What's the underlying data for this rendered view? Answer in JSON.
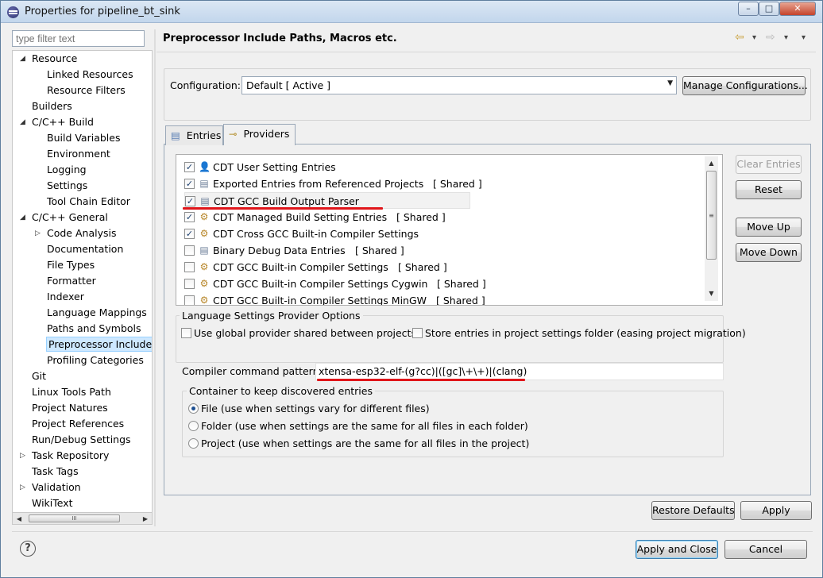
{
  "window": {
    "title": "Properties for pipeline_bt_sink",
    "controls": [
      "–",
      "□",
      "✕"
    ]
  },
  "filter": {
    "placeholder": "type filter text"
  },
  "tree": [
    {
      "label": "Resource",
      "indent": 0,
      "expander": "◢"
    },
    {
      "label": "Linked Resources",
      "indent": 1
    },
    {
      "label": "Resource Filters",
      "indent": 1
    },
    {
      "label": "Builders",
      "indent": 0
    },
    {
      "label": "C/C++ Build",
      "indent": 0,
      "expander": "◢"
    },
    {
      "label": "Build Variables",
      "indent": 1
    },
    {
      "label": "Environment",
      "indent": 1
    },
    {
      "label": "Logging",
      "indent": 1
    },
    {
      "label": "Settings",
      "indent": 1
    },
    {
      "label": "Tool Chain Editor",
      "indent": 1
    },
    {
      "label": "C/C++ General",
      "indent": 0,
      "expander": "◢"
    },
    {
      "label": "Code Analysis",
      "indent": 1,
      "expander": "▷"
    },
    {
      "label": "Documentation",
      "indent": 1
    },
    {
      "label": "File Types",
      "indent": 1
    },
    {
      "label": "Formatter",
      "indent": 1
    },
    {
      "label": "Indexer",
      "indent": 1
    },
    {
      "label": "Language Mappings",
      "indent": 1
    },
    {
      "label": "Paths and Symbols",
      "indent": 1
    },
    {
      "label": "Preprocessor Include",
      "indent": 1,
      "selected": true
    },
    {
      "label": "Profiling Categories",
      "indent": 1
    },
    {
      "label": "Git",
      "indent": 0
    },
    {
      "label": "Linux Tools Path",
      "indent": 0
    },
    {
      "label": "Project Natures",
      "indent": 0
    },
    {
      "label": "Project References",
      "indent": 0
    },
    {
      "label": "Run/Debug Settings",
      "indent": 0
    },
    {
      "label": "Task Repository",
      "indent": 0,
      "expander": "▷"
    },
    {
      "label": "Task Tags",
      "indent": 0
    },
    {
      "label": "Validation",
      "indent": 0,
      "expander": "▷"
    },
    {
      "label": "WikiText",
      "indent": 0
    }
  ],
  "tree_scroll": {
    "left": "◀",
    "right": "▶",
    "thumb": "III"
  },
  "header": {
    "title": "Preprocessor Include Paths, Macros etc.",
    "back": "⇦",
    "back_menu": "▾",
    "forward": "⇨",
    "forward_menu": "▾",
    "view_menu": "▾"
  },
  "configuration": {
    "label": "Configuration:",
    "value": "Default  [ Active ]",
    "manage_button": "Manage Configurations..."
  },
  "tabs": [
    {
      "label": "Entries",
      "icon": "▤",
      "active": false
    },
    {
      "label": "Providers",
      "icon": "⊸",
      "active": true
    }
  ],
  "providers": [
    {
      "label": "CDT User Setting Entries",
      "shared": "",
      "checked": true,
      "icon": "👤",
      "icon_name": "user-icon"
    },
    {
      "label": "Exported Entries from Referenced Projects",
      "shared": "[ Shared ]",
      "checked": true,
      "icon": "▤",
      "icon_name": "document-icon"
    },
    {
      "label": "CDT GCC Build Output Parser",
      "shared": "",
      "checked": true,
      "icon": "▤",
      "icon_name": "parser-icon",
      "selected": true
    },
    {
      "label": "CDT Managed Build Setting Entries",
      "shared": "[ Shared ]",
      "checked": true,
      "icon": "⚙",
      "icon_name": "gears-icon"
    },
    {
      "label": "CDT Cross GCC Built-in Compiler Settings",
      "shared": "",
      "checked": true,
      "icon": "⚙",
      "icon_name": "compiler-icon"
    },
    {
      "label": "Binary Debug Data Entries",
      "shared": "[ Shared ]",
      "checked": false,
      "icon": "▤",
      "icon_name": "document-icon"
    },
    {
      "label": "CDT GCC Built-in Compiler Settings",
      "shared": "[ Shared ]",
      "checked": false,
      "icon": "⚙",
      "icon_name": "compiler-icon"
    },
    {
      "label": "CDT GCC Built-in Compiler Settings Cygwin",
      "shared": "[ Shared ]",
      "checked": false,
      "icon": "⚙",
      "icon_name": "compiler-icon"
    },
    {
      "label": "CDT GCC Built-in Compiler Settings MinGW",
      "shared": "[ Shared ]",
      "checked": false,
      "icon": "⚙",
      "icon_name": "compiler-icon"
    }
  ],
  "list_scroll": {
    "up": "▲",
    "down": "▼",
    "grip": "≡"
  },
  "side_buttons": {
    "clear": "Clear Entries",
    "reset": "Reset",
    "move_up": "Move Up",
    "move_down": "Move Down"
  },
  "options": {
    "title": "Language Settings Provider Options",
    "global_provider": "Use global provider shared between projects",
    "store_entries": "Store entries in project settings folder (easing project migration)",
    "pattern_label": "Compiler command pattern:",
    "pattern_value": "xtensa-esp32-elf-(g?cc)|([gc]\\+\\+)|(clang)"
  },
  "container": {
    "title": "Container to keep discovered entries",
    "options": [
      {
        "label": "File (use when settings vary for different files)",
        "selected": true
      },
      {
        "label": "Folder (use when settings are the same for all files in each folder)",
        "selected": false
      },
      {
        "label": "Project (use when settings are the same for all files in the project)",
        "selected": false
      }
    ]
  },
  "page_buttons": {
    "restore": "Restore Defaults",
    "apply": "Apply"
  },
  "dialog_buttons": {
    "help": "?",
    "apply_close": "Apply and Close",
    "cancel": "Cancel"
  },
  "colors": {
    "annotation_underline": "#e0151a",
    "selection": "#cde8ff"
  }
}
